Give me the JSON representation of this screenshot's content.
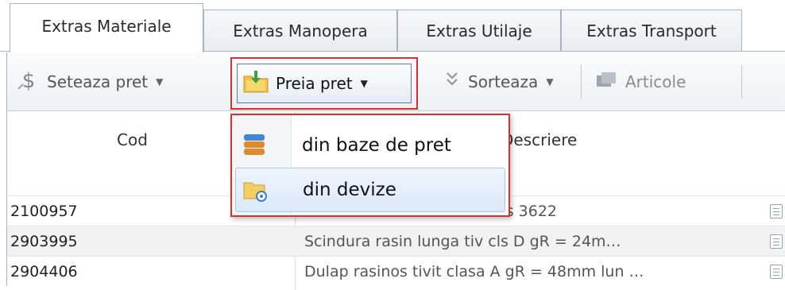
{
  "tabs": [
    {
      "label": "Extras Materiale",
      "active": true
    },
    {
      "label": "Extras Manopera",
      "active": false
    },
    {
      "label": "Extras Utilaje",
      "active": false
    },
    {
      "label": "Extras Transport",
      "active": false
    }
  ],
  "toolbar": {
    "seteaza_pret": {
      "label": "Seteaza pret",
      "icon": "dollar-icon"
    },
    "preia_pret": {
      "label": "Preia pret",
      "icon": "folder-download-icon"
    },
    "sorteaza": {
      "label": "Sorteaza",
      "icon": "sort-icon"
    },
    "articole": {
      "label": "Articole",
      "icon": "articles-icon",
      "disabled": true
    }
  },
  "table": {
    "columns": [
      "Cod",
      "Descriere"
    ],
    "rows": [
      {
        "cod": "2100957",
        "descriere": "Beton de ciment    C 200   stas  3622"
      },
      {
        "cod": "2903995",
        "descriere": "Scindura rasin lunga    tiv cls D   gR = 24m…"
      },
      {
        "cod": "2904406",
        "descriere": "Dulap rasinos tivit clasa A gR = 48mm lun …"
      }
    ]
  },
  "dropdown": {
    "items": [
      {
        "label": "din baze de pret",
        "icon": "database-icon"
      },
      {
        "label": "din devize",
        "icon": "folder-search-icon",
        "highlighted": true
      }
    ]
  },
  "colors": {
    "highlight_border": "#d9302f",
    "menu_hover": "#dce9f8",
    "tab_border": "#a9b3bf"
  }
}
